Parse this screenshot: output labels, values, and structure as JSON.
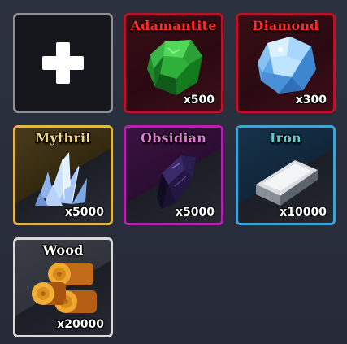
{
  "inventory": {
    "add_slot": {
      "icon": "plus-icon"
    },
    "items": [
      {
        "name": "Adamantite",
        "quantity": "x500",
        "name_color": "#ff2a2a",
        "border_color": "#b5142b",
        "icon": "adamantite-gem-icon"
      },
      {
        "name": "Diamond",
        "quantity": "x300",
        "name_color": "#ff2a2a",
        "border_color": "#b5142b",
        "icon": "diamond-gem-icon"
      },
      {
        "name": "Mythril",
        "quantity": "x5000",
        "name_color": "#f2d98a",
        "border_color": "#e0b64a",
        "icon": "mythril-crystal-icon"
      },
      {
        "name": "Obsidian",
        "quantity": "x5000",
        "name_color": "#e07ad9",
        "border_color": "#b321b0",
        "icon": "obsidian-shard-icon"
      },
      {
        "name": "Iron",
        "quantity": "x10000",
        "name_color": "#5ad0d6",
        "border_color": "#3fa3d6",
        "icon": "iron-ingot-icon"
      },
      {
        "name": "Wood",
        "quantity": "x20000",
        "name_color": "#ffffff",
        "border_color": "#d9d9d9",
        "icon": "wood-logs-icon"
      }
    ]
  }
}
